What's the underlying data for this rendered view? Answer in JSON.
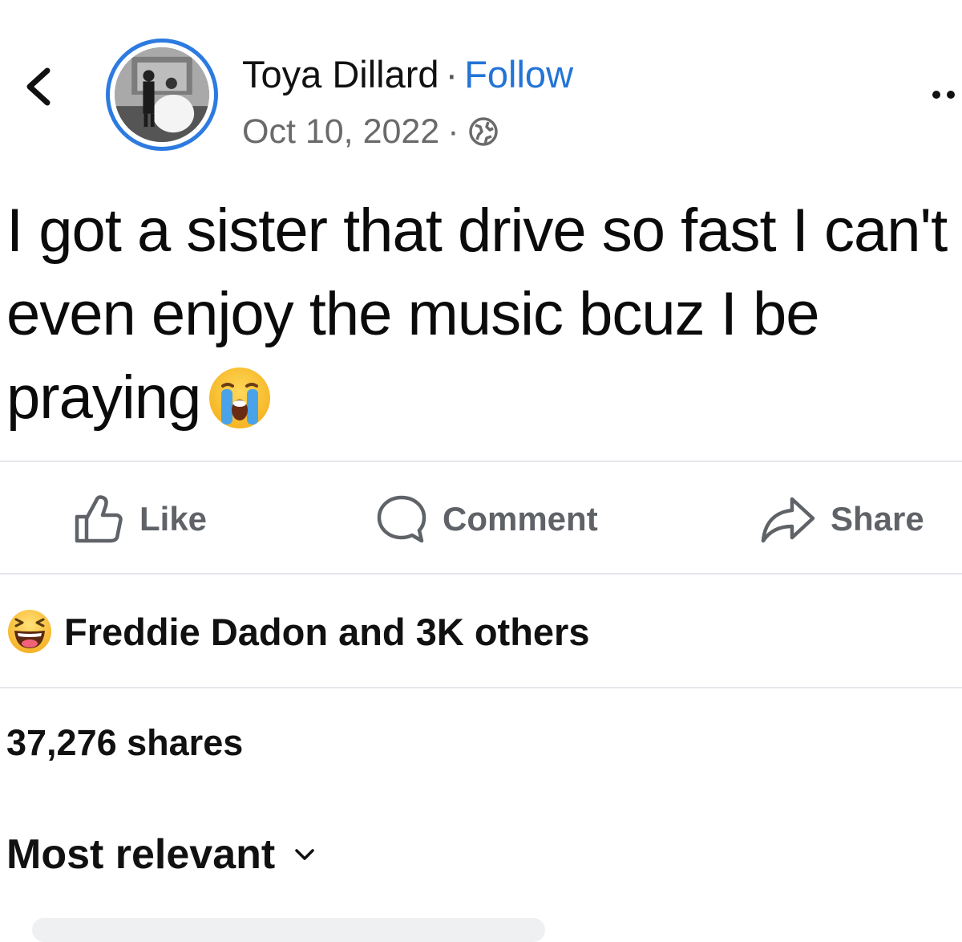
{
  "header": {
    "author_name": "Toya Dillard",
    "separator": "·",
    "follow_label": "Follow",
    "date": "Oct 10, 2022",
    "audience_icon": "globe-icon",
    "back_icon": "back-chevron-icon",
    "more_icon": "more-options-icon"
  },
  "post": {
    "text": "I got a sister that drive so fast I can't even enjoy the music bcuz I be praying",
    "emoji": "loudly-crying-face"
  },
  "actions": {
    "like_label": "Like",
    "comment_label": "Comment",
    "share_label": "Share"
  },
  "reactions": {
    "icon": "laughing-face-icon",
    "summary": "Freddie Dadon and 3K others"
  },
  "stats": {
    "shares": "37,276 shares"
  },
  "comments": {
    "sort_label": "Most relevant"
  },
  "colors": {
    "accent": "#2374d6",
    "avatar_ring": "#2d7be0",
    "muted_text": "#6a6a6a",
    "divider": "#e4e6eb",
    "action_text": "#5f6368"
  }
}
